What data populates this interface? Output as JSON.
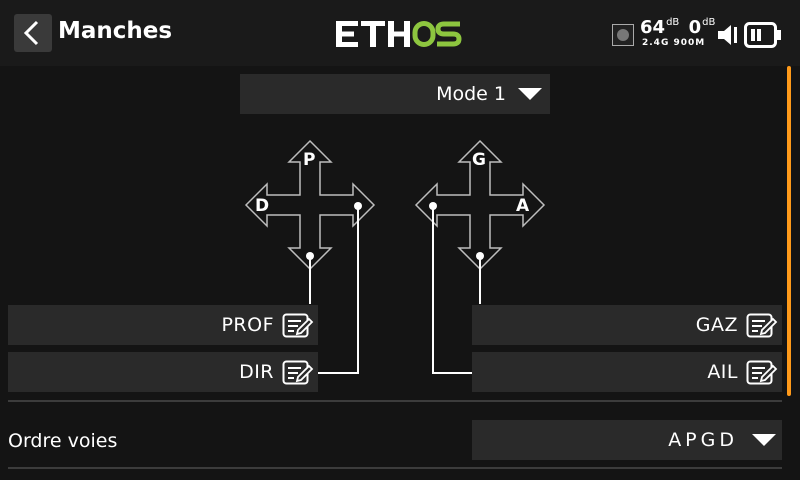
{
  "header": {
    "title": "Manches",
    "logo": "ETHOS",
    "rssi_value": "64",
    "rssi_unit": "dB",
    "second_value": "0",
    "second_unit": "dB",
    "band": "2.4G 900M"
  },
  "mode_select": {
    "value": "Mode 1"
  },
  "sticks": {
    "left": {
      "up": "P",
      "left": "D"
    },
    "right": {
      "up": "G",
      "right": "A"
    }
  },
  "channels": {
    "prof": "PROF",
    "dir": "DIR",
    "gaz": "GAZ",
    "ail": "AIL"
  },
  "order": {
    "label": "Ordre voies",
    "value": "APGD"
  },
  "colors": {
    "accent_orange": "#ff9a1a",
    "logo_green": "#8dc63f",
    "panel": "#2a2a2a"
  },
  "icons": [
    "back-icon",
    "record-icon",
    "speaker-icon",
    "battery-icon",
    "edit-icon",
    "dropdown-icon"
  ]
}
